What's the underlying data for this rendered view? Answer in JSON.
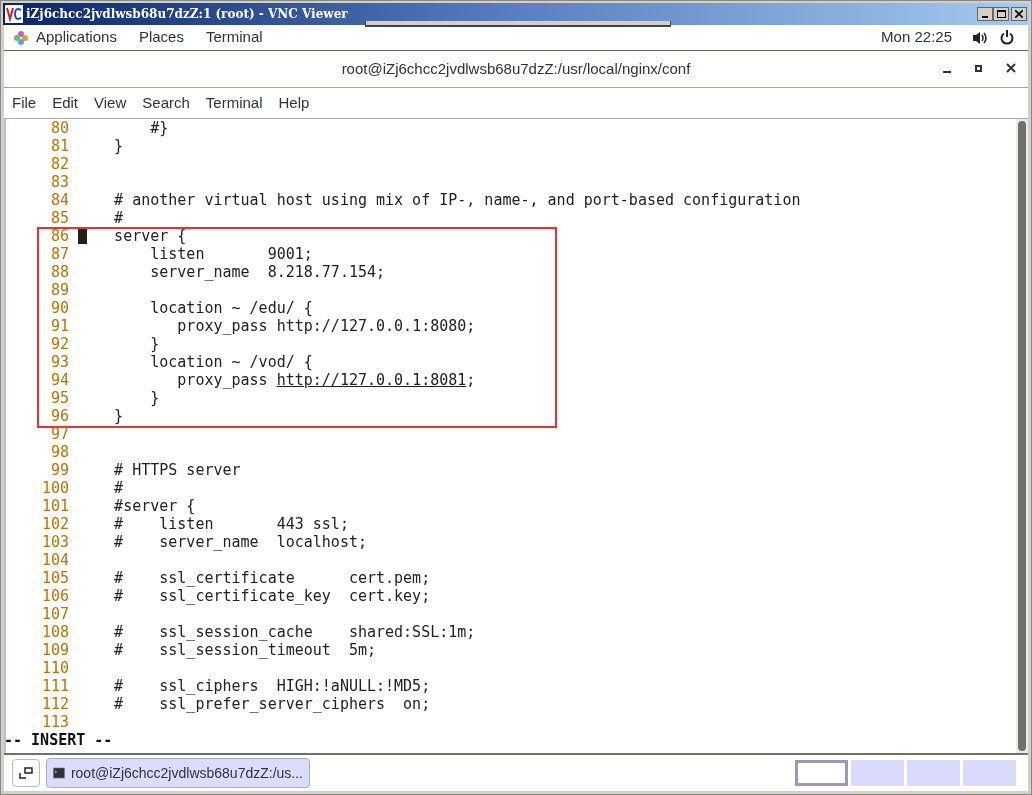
{
  "viewer": {
    "title": "iZj6chcc2jvdlwsb68u7dzZ:1 (root) - VNC Viewer"
  },
  "top_panel": {
    "menus": [
      "Applications",
      "Places",
      "Terminal"
    ],
    "clock": "Mon 22:25"
  },
  "terminal": {
    "title": "root@iZj6chcc2jvdlwsb68u7dzZ:/usr/local/nginx/conf",
    "menu": [
      "File",
      "Edit",
      "View",
      "Search",
      "Terminal",
      "Help"
    ],
    "blocks": [
      {
        "framed": false,
        "lines": [
          {
            "number": "80",
            "text": "        #}",
            "cursor": false
          },
          {
            "number": "81",
            "text": "    }",
            "cursor": false
          },
          {
            "number": "82",
            "cursor": false
          },
          {
            "number": "83",
            "cursor": false
          },
          {
            "number": "84",
            "text": "    # another virtual host using mix of IP-, name-, and port-based configuration",
            "cursor": false
          },
          {
            "number": "85",
            "text": "    #",
            "cursor": false
          }
        ]
      },
      {
        "framed": true,
        "lines": [
          {
            "number": "86",
            "text": "    server {",
            "cursor": true
          },
          {
            "number": "87",
            "text": "        listen       9001;",
            "cursor": false
          },
          {
            "number": "88",
            "text": "        server_name  8.218.77.154;",
            "cursor": false
          },
          {
            "number": "89",
            "cursor": false
          },
          {
            "number": "90",
            "text": "        location ~ /edu/ {",
            "cursor": false
          },
          {
            "number": "91",
            "text": "           proxy_pass http://127.0.0.1:8080;",
            "cursor": false
          },
          {
            "number": "92",
            "text": "        }",
            "cursor": false
          },
          {
            "number": "93",
            "text": "        location ~ /vod/ {",
            "cursor": false
          },
          {
            "number": "94",
            "text": "           proxy_pass ",
            "link": "http://127.0.0.1:8081",
            "after": ";",
            "cursor": false
          },
          {
            "number": "95",
            "text": "        }",
            "cursor": false
          },
          {
            "number": "96",
            "text": "    }",
            "cursor": false
          }
        ]
      },
      {
        "framed": false,
        "lines": [
          {
            "number": "97",
            "cursor": false
          },
          {
            "number": "98",
            "cursor": false
          },
          {
            "number": "99",
            "text": "    # HTTPS server",
            "cursor": false
          },
          {
            "number": "100",
            "text": "    #",
            "cursor": false
          },
          {
            "number": "101",
            "text": "    #server {",
            "cursor": false
          },
          {
            "number": "102",
            "text": "    #    listen       443 ssl;",
            "cursor": false
          },
          {
            "number": "103",
            "text": "    #    server_name  localhost;",
            "cursor": false
          },
          {
            "number": "104",
            "cursor": false
          },
          {
            "number": "105",
            "text": "    #    ssl_certificate      cert.pem;",
            "cursor": false
          },
          {
            "number": "106",
            "text": "    #    ssl_certificate_key  cert.key;",
            "cursor": false
          },
          {
            "number": "107",
            "cursor": false
          },
          {
            "number": "108",
            "text": "    #    ssl_session_cache    shared:SSL:1m;",
            "cursor": false
          },
          {
            "number": "109",
            "text": "    #    ssl_session_timeout  5m;",
            "cursor": false
          },
          {
            "number": "110",
            "cursor": false
          },
          {
            "number": "111",
            "text": "    #    ssl_ciphers  HIGH:!aNULL:!MD5;",
            "cursor": false
          },
          {
            "number": "112",
            "text": "    #    ssl_prefer_server_ciphers  on;",
            "cursor": false
          },
          {
            "number": "113",
            "cursor": false
          }
        ]
      }
    ],
    "mode": "-- INSERT --"
  },
  "taskbar": {
    "task": "root@iZj6chcc2jvdlwsb68u7dzZ:/us...",
    "workspaces": [
      {
        "selected": true
      },
      {
        "selected": false
      },
      {
        "selected": false
      },
      {
        "selected": false
      }
    ]
  }
}
